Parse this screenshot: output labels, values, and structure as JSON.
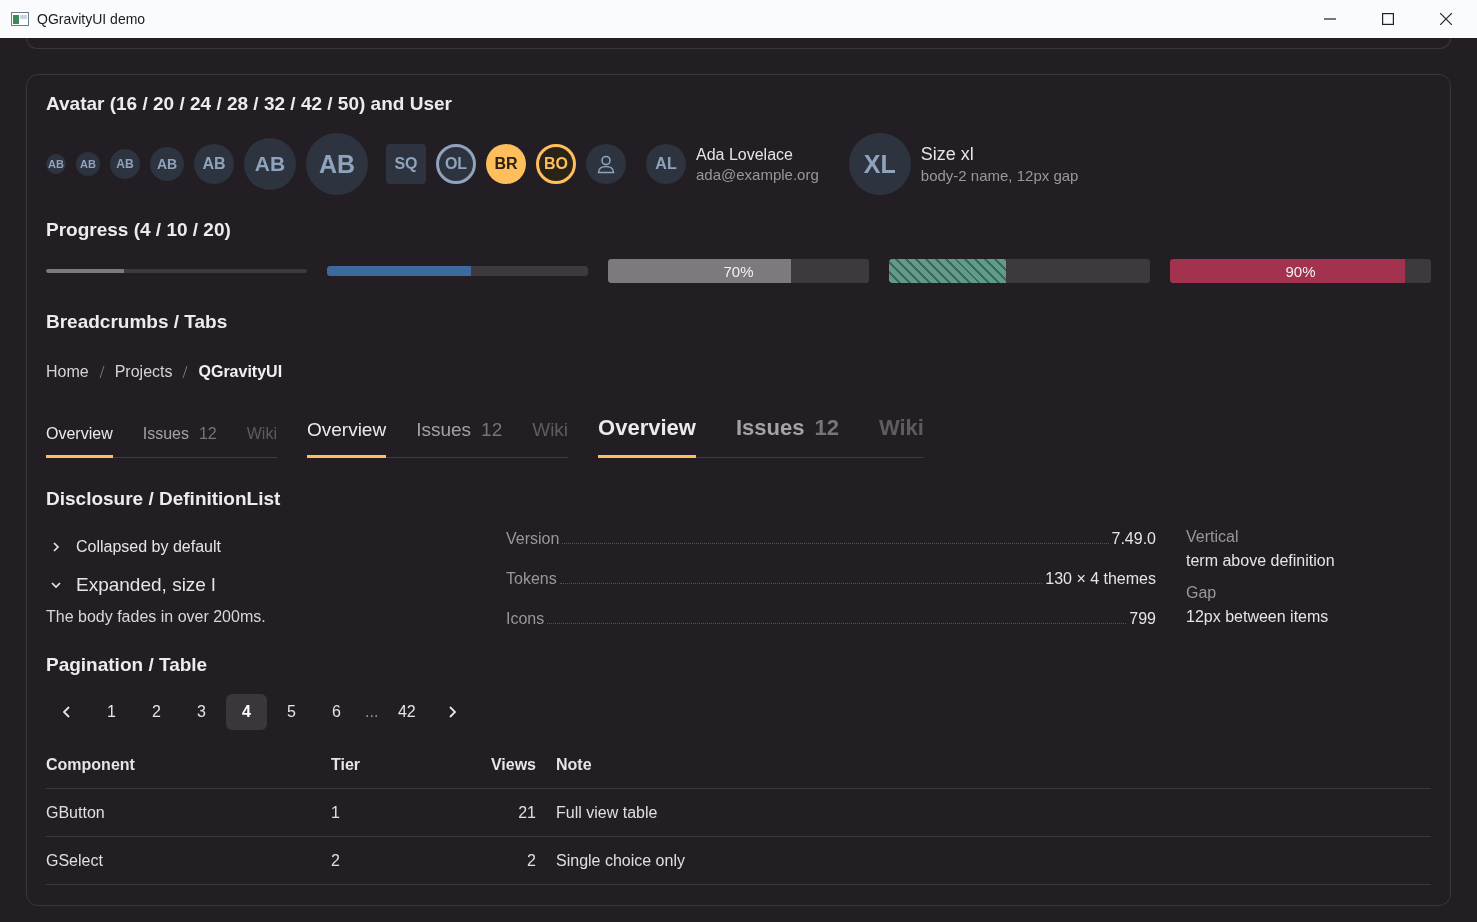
{
  "window": {
    "title": "QGravityUI demo"
  },
  "avatar_section": {
    "heading": "Avatar (16 / 20 / 24 / 28 / 32 / 42 / 50) and User",
    "size_scale": [
      {
        "initials": "AB"
      },
      {
        "initials": "AB"
      },
      {
        "initials": "AB"
      },
      {
        "initials": "AB"
      },
      {
        "initials": "AB"
      },
      {
        "initials": "AB"
      },
      {
        "initials": "AB"
      }
    ],
    "variants": [
      {
        "initials": "SQ",
        "kind": "square"
      },
      {
        "initials": "OL",
        "kind": "outline"
      },
      {
        "initials": "BR",
        "kind": "accent"
      },
      {
        "initials": "BO",
        "kind": "outline-accent"
      },
      {
        "kind": "icon"
      }
    ],
    "users": [
      {
        "initials": "AL",
        "kind": "medium",
        "name": "Ada Lovelace",
        "description": "ada@example.org"
      },
      {
        "initials": "XL",
        "kind": "large",
        "name": "Size xl",
        "description": "body-2 name, 12px gap"
      }
    ]
  },
  "progress_section": {
    "heading": "Progress (4 / 10 / 20)",
    "bars": [
      {
        "kind": "thin",
        "level": 0.3,
        "color": "#7d7a7e",
        "striped": false
      },
      {
        "kind": "medium",
        "level": 0.55,
        "color": "#3d6a9c",
        "striped": false
      },
      {
        "kind": "thick",
        "level": 0.7,
        "color": "#7d7a7e",
        "striped": false,
        "label": "70%"
      },
      {
        "kind": "thick",
        "level": 0.45,
        "color": "#5f9c8c",
        "striped": true
      },
      {
        "kind": "thick",
        "level": 0.9,
        "color": "#a3324e",
        "striped": false,
        "label": "90%"
      }
    ]
  },
  "breadcrumbs_section": {
    "heading": "Breadcrumbs / Tabs",
    "breadcrumbs": [
      {
        "label": "Home",
        "current": false
      },
      {
        "label": "Projects",
        "current": false
      },
      {
        "label": "QGravityUI",
        "current": true
      }
    ],
    "tab_groups": [
      {
        "kind": "small",
        "tabs": [
          {
            "label": "Overview",
            "selected": true,
            "disabled": false
          },
          {
            "label": "Issues",
            "count": "12",
            "selected": false,
            "disabled": false
          },
          {
            "label": "Wiki",
            "selected": false,
            "disabled": true
          }
        ]
      },
      {
        "kind": "medium",
        "tabs": [
          {
            "label": "Overview",
            "selected": true,
            "disabled": false
          },
          {
            "label": "Issues",
            "count": "12",
            "selected": false,
            "disabled": false
          },
          {
            "label": "Wiki",
            "selected": false,
            "disabled": true
          }
        ]
      },
      {
        "kind": "large",
        "tabs": [
          {
            "label": "Overview",
            "selected": true,
            "disabled": false
          },
          {
            "label": "Issues",
            "count": "12",
            "selected": false,
            "disabled": false
          },
          {
            "label": "Wiki",
            "selected": false,
            "disabled": true
          }
        ]
      }
    ]
  },
  "disclosure_section": {
    "heading": "Disclosure / DefinitionList",
    "disclosures": [
      {
        "label": "Collapsed by default",
        "kind": "medium",
        "expanded": false
      },
      {
        "label": "Expanded, size l",
        "kind": "large",
        "expanded": true,
        "body": "The body fades in over 200ms."
      }
    ],
    "definition_list": [
      {
        "term": "Version",
        "definition": "7.49.0"
      },
      {
        "term": "Tokens",
        "definition": "130 × 4 themes"
      },
      {
        "term": "Icons",
        "definition": "799"
      }
    ],
    "vertical_list": [
      {
        "term": "Vertical",
        "definition": "term above definition"
      },
      {
        "term": "Gap",
        "definition": "12px between items"
      }
    ]
  },
  "pagination_section": {
    "heading": "Pagination / Table",
    "pages": [
      {
        "label": "1",
        "kind": "page",
        "selected": false
      },
      {
        "label": "2",
        "kind": "page",
        "selected": false
      },
      {
        "label": "3",
        "kind": "page",
        "selected": false
      },
      {
        "label": "4",
        "kind": "page",
        "selected": true
      },
      {
        "label": "5",
        "kind": "page",
        "selected": false
      },
      {
        "label": "6",
        "kind": "page",
        "selected": false
      },
      {
        "label": "...",
        "kind": "ellipsis"
      },
      {
        "label": "42",
        "kind": "page",
        "selected": false
      }
    ],
    "table": {
      "columns": [
        "Component",
        "Tier",
        "Views",
        "Note"
      ],
      "rows": [
        [
          "GButton",
          "1",
          "21",
          "Full view table"
        ],
        [
          "GSelect",
          "2",
          "2",
          "Single choice only"
        ]
      ]
    }
  }
}
